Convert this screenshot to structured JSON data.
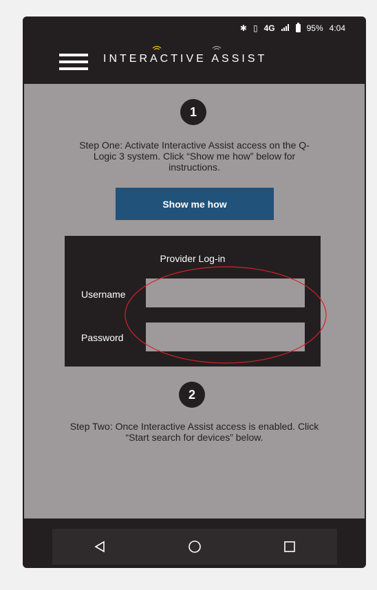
{
  "status_bar": {
    "bluetooth_icon": "bluetooth-icon",
    "vibrate_icon": "vibrate-icon",
    "network_label": "4G",
    "signal_icon": "signal-icon",
    "battery_icon": "battery-icon",
    "battery_percent": "95%",
    "time": "4:04"
  },
  "app_bar": {
    "menu_icon": "hamburger-menu-icon",
    "title": "INTERACTIVE ASSIST",
    "accent_color": "#f5c400"
  },
  "step_one": {
    "badge": "1",
    "text": "Step One: Activate Interactive Assist access on the Q-Logic 3 system. Click “Show me how” below for instructions.",
    "button_label": "Show me how"
  },
  "login": {
    "title": "Provider Log-in",
    "username_label": "Username",
    "username_value": "",
    "password_label": "Password",
    "password_value": ""
  },
  "step_two": {
    "badge": "2",
    "text": "Step Two: Once Interactive Assist access is enabled. Click “Start search for devices” below."
  },
  "nav_bar": {
    "back_icon": "back-triangle-icon",
    "home_icon": "home-circle-icon",
    "recents_icon": "recents-square-icon"
  },
  "colors": {
    "background": "#9e999a",
    "dark": "#231f20",
    "button": "#20527a",
    "annotation": "#d9202a"
  }
}
